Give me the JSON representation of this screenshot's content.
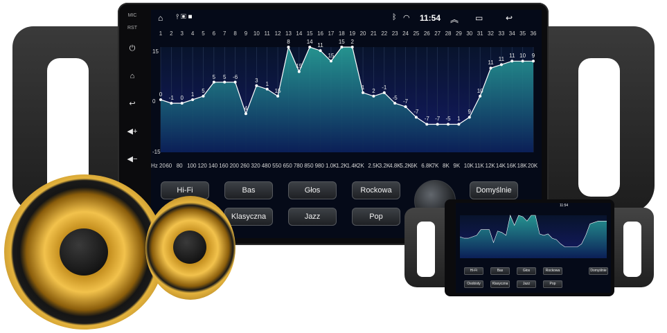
{
  "status": {
    "time": "11:54"
  },
  "side": {
    "mic": "MIC",
    "rst": "RST"
  },
  "eq": {
    "scale": {
      "top": "15",
      "mid": "0",
      "bottom": "-15"
    },
    "bands": [
      "1",
      "2",
      "3",
      "4",
      "5",
      "6",
      "7",
      "8",
      "9",
      "10",
      "11",
      "12",
      "13",
      "14",
      "15",
      "16",
      "17",
      "18",
      "19",
      "20",
      "21",
      "22",
      "23",
      "24",
      "25",
      "26",
      "27",
      "28",
      "29",
      "30",
      "31",
      "32",
      "33",
      "34",
      "35",
      "36"
    ],
    "freqs": [
      "Hz 20",
      "60",
      "80",
      "100",
      "120",
      "140",
      "160",
      "200",
      "260",
      "320",
      "480",
      "550",
      "650",
      "780",
      "850",
      "980",
      "1.0K",
      "1.2K",
      "1.4K",
      "2K",
      "2.5K",
      "3.2K",
      "4.8K",
      "5.2K",
      "6K",
      "6.8K",
      "7K",
      "8K",
      "9K",
      "10K",
      "11K",
      "12K",
      "14K",
      "16K",
      "18K",
      "20K"
    ],
    "levels": [
      0,
      -1,
      -1,
      0,
      1,
      5,
      5,
      5,
      -4,
      4,
      3,
      1,
      15,
      8,
      15,
      14,
      11,
      15,
      15,
      2,
      1,
      2,
      -1,
      -2,
      -5,
      -7,
      -7,
      -7,
      -7,
      -5,
      1,
      9,
      10,
      11,
      11,
      11
    ],
    "labels": [
      "0",
      "-1",
      "0",
      "1",
      "5",
      "5",
      "5",
      "-6",
      "4",
      "3",
      "1",
      "15",
      "8",
      "15",
      "14",
      "11",
      "15",
      "15",
      "2",
      "1",
      "2",
      "-1",
      "-5",
      "-7",
      "-7",
      "-7",
      "-7",
      "-5",
      "1",
      "9",
      "10",
      "11",
      "11",
      "11",
      "10",
      "9"
    ]
  },
  "presets": {
    "hifi": "Hi-Fi",
    "bas": "Bas",
    "glos": "Głos",
    "rockowa": "Rockowa",
    "domyslnie": "Domyślnie",
    "klasyczna": "Klasyczna",
    "jazz": "Jazz",
    "pop": "Pop"
  },
  "mini": {
    "time": "11:54",
    "row1": [
      "Hi-Fi",
      "Bas",
      "Głos",
      "Rockowa",
      "Domyślnie"
    ],
    "row2": [
      "Osobisty",
      "Klasyczna",
      "Jazz",
      "Pop"
    ]
  },
  "colors": {
    "accent": "#1f8a8a",
    "curve": "#ffffff"
  }
}
